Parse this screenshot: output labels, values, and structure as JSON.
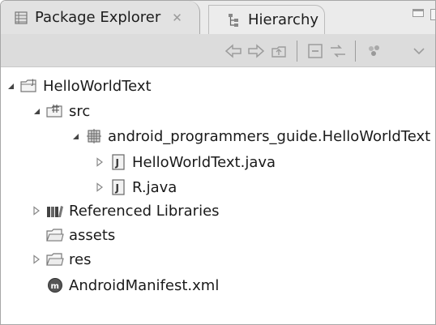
{
  "tabs": [
    {
      "label": "Package Explorer",
      "active": true,
      "close_glyph": "✕"
    },
    {
      "label": "Hierarchy",
      "active": false
    }
  ],
  "toolbar": {
    "buttons": [
      "back-icon",
      "forward-icon",
      "up-icon",
      "collapse-all-icon",
      "link-with-editor-icon",
      "filters-icon",
      "view-menu-icon"
    ]
  },
  "tree": [
    {
      "label": "HelloWorldText",
      "icon": "project-icon",
      "expanded": true,
      "level": 0
    },
    {
      "label": "src",
      "icon": "source-folder-icon",
      "expanded": true,
      "level": 1
    },
    {
      "label": "android_programmers_guide.HelloWorldText",
      "icon": "package-icon",
      "expanded": true,
      "level": 2
    },
    {
      "label": "HelloWorldText.java",
      "icon": "java-file-icon",
      "expanded": false,
      "level": 3
    },
    {
      "label": "R.java",
      "icon": "java-file-icon",
      "expanded": false,
      "level": 3
    },
    {
      "label": "Referenced Libraries",
      "icon": "library-icon",
      "expanded": false,
      "level": 1
    },
    {
      "label": "assets",
      "icon": "folder-icon",
      "level": 1
    },
    {
      "label": "res",
      "icon": "folder-icon",
      "expanded": false,
      "level": 1
    },
    {
      "label": "AndroidManifest.xml",
      "icon": "xml-file-icon",
      "level": 1
    }
  ],
  "colors": {
    "tab_active_bg": "#e2e2e2",
    "toolbar_bg": "#dcdcdc",
    "border": "#a7a7a7",
    "icon_gray": "#666666"
  }
}
